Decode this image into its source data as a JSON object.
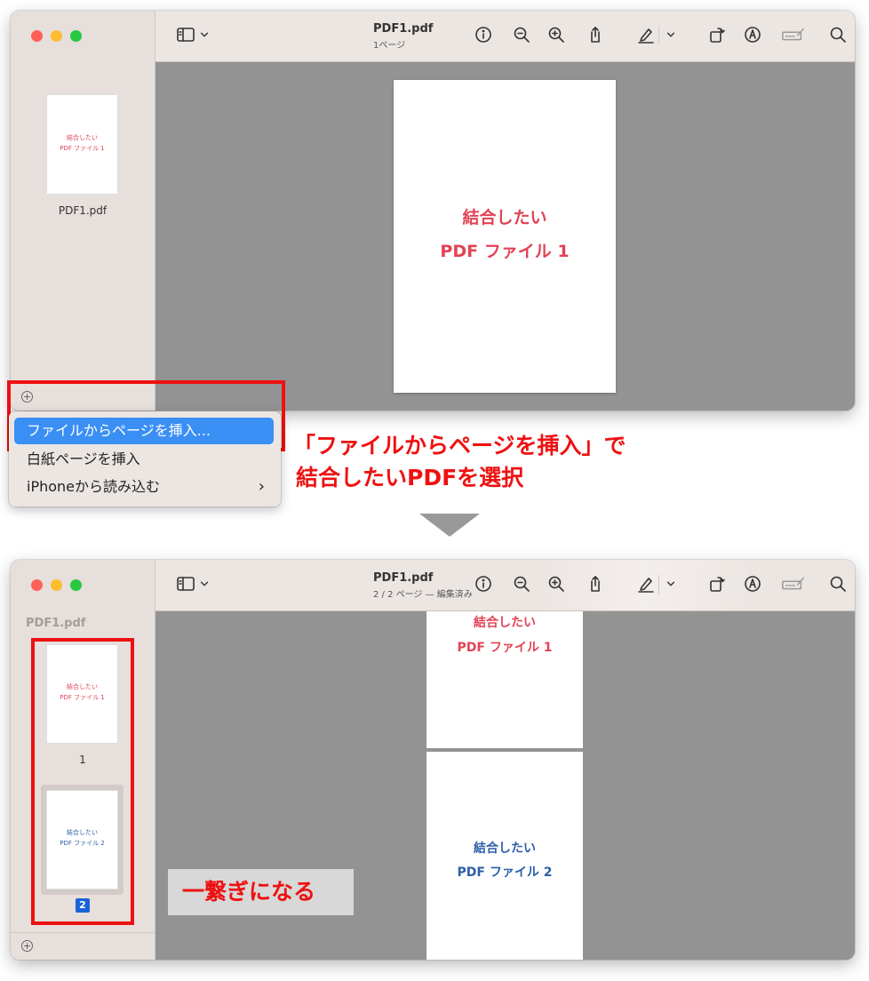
{
  "window1": {
    "title": "PDF1.pdf",
    "subtitle": "1ページ",
    "sidebar_thumb_label": "PDF1.pdf",
    "page_line1": "結合したい",
    "page_line2": "PDF ファイル 1"
  },
  "menu": {
    "insert_from_file": "ファイルからページを挿入...",
    "insert_blank": "白紙ページを挿入",
    "import_iphone": "iPhoneから読み込む",
    "submenu_chevron": "›"
  },
  "annotation1": {
    "line1": "「ファイルからページを挿入」で",
    "line2": "結合したいPDFを選択"
  },
  "window2": {
    "title": "PDF1.pdf",
    "subtitle": "2 / 2 ページ — 編集済み",
    "sidebar_header": "PDF1.pdf",
    "page1_line1": "結合したい",
    "page1_line2": "PDF ファイル 1",
    "page2_line1": "結合したい",
    "page2_line2": "PDF ファイル 2",
    "thumb1_number": "1",
    "thumb2_number": "2"
  },
  "callout": "一繋ぎになる",
  "icons": [
    "sidebar-toggle-icon",
    "chevron-down-icon",
    "info-icon",
    "zoom-out-icon",
    "zoom-in-icon",
    "share-icon",
    "highlight-pen-icon",
    "rotate-icon",
    "markup-icon",
    "signature-icon",
    "search-icon",
    "add-circle-icon"
  ],
  "colors": {
    "accent_red": "#ee1111",
    "doc1_text": "#e24355",
    "doc2_text": "#2c5fa8",
    "menu_selection": "#3a8ff5"
  }
}
